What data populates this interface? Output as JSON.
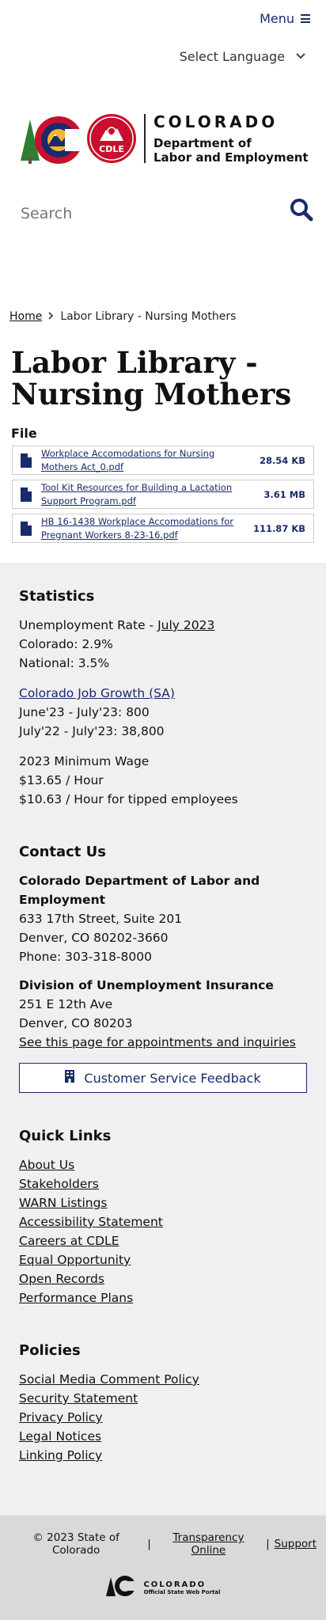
{
  "header": {
    "menu_label": "Menu",
    "language_label": "Select Language",
    "logo": {
      "state": "COLORADO",
      "dept_line1": "Department of",
      "dept_line2": "Labor and Employment",
      "badge": "CDLE"
    },
    "search_placeholder": "Search"
  },
  "breadcrumb": {
    "home": "Home",
    "current": "Labor Library - Nursing Mothers"
  },
  "page_title": "Labor Library - Nursing Mothers",
  "file_heading": "File",
  "files": [
    {
      "name": "Workplace Accomodations for Nursing Mothers Act_0.pdf",
      "size": "28.54 KB"
    },
    {
      "name": "Tool Kit Resources for Building a Lactation Support Program.pdf",
      "size": "3.61 MB"
    },
    {
      "name": "HB 16-1438 Workplace Accomodations for Pregnant Workers 8-23-16.pdf",
      "size": "111.87 KB"
    }
  ],
  "statistics": {
    "heading": "Statistics",
    "unemployment_label": "Unemployment Rate - ",
    "unemployment_link": "July 2023",
    "colorado": "Colorado: 2.9%",
    "national": "National: 3.5%",
    "job_growth_link": "Colorado Job Growth (SA)",
    "growth_1": "June'23 - July'23: 800",
    "growth_2": "July'22 - July'23: 38,800",
    "min_wage_title": "2023 Minimum Wage",
    "min_wage_1": "$13.65 / Hour",
    "min_wage_2": "$10.63 / Hour for tipped employees"
  },
  "contact": {
    "heading": "Contact Us",
    "org1": "Colorado Department of Labor and Employment",
    "org1_addr1": "633 17th Street, Suite 201",
    "org1_addr2": "Denver, CO  80202-3660",
    "org1_phone": "Phone: 303-318-8000",
    "org2": "Division of Unemployment Insurance",
    "org2_addr1": "251 E 12th Ave",
    "org2_addr2": "Denver, CO  80203",
    "org2_link": "See this page for appointments and inquiries",
    "feedback_button": "Customer Service Feedback"
  },
  "quick_links": {
    "heading": "Quick Links",
    "items": [
      "About Us",
      "Stakeholders",
      "WARN Listings",
      "Accessibility Statement",
      "Careers at CDLE",
      "Equal Opportunity",
      "Open Records",
      "Performance Plans"
    ]
  },
  "policies": {
    "heading": "Policies",
    "items": [
      "Social Media Comment Policy",
      "Security Statement",
      "Privacy Policy",
      "Legal Notices",
      "Linking Policy"
    ]
  },
  "bottom": {
    "copyright": "© 2023 State of Colorado",
    "sep": "|",
    "transparency": "Transparency Online",
    "support": "Support",
    "portal_state": "COLORADO",
    "portal_sub": "Official State Web Portal"
  },
  "colors": {
    "link_blue": "#1a2a6c",
    "co_red": "#c8102e",
    "footer_bg": "#f0f0f2",
    "bottom_bg": "#d9d9db"
  }
}
